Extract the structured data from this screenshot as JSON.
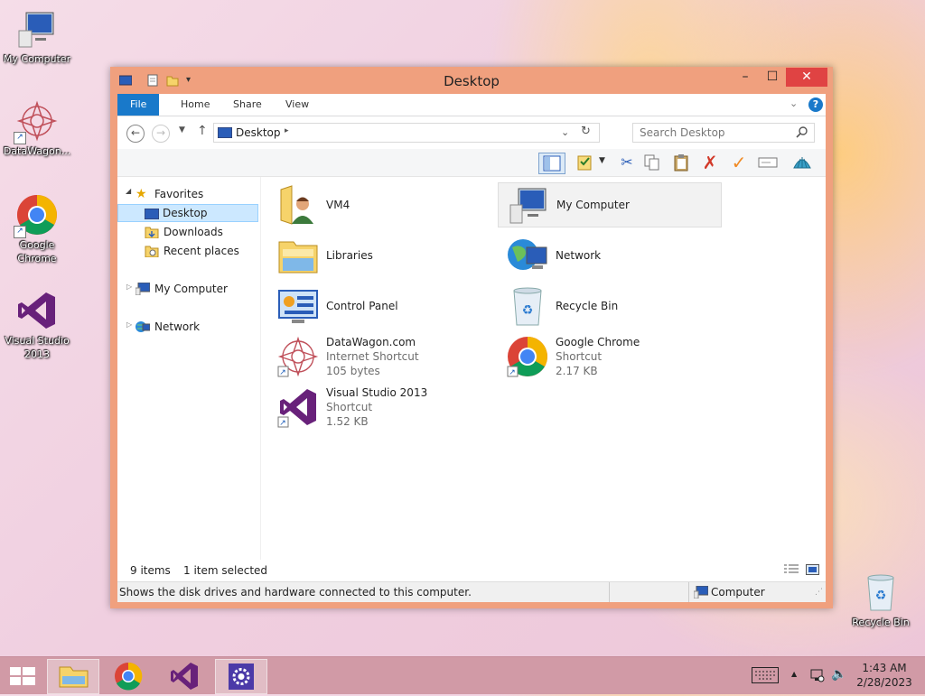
{
  "desktop": {
    "icons": [
      {
        "label": "My Computer",
        "icon": "my-computer-icon"
      },
      {
        "label": "DataWagon...",
        "icon": "datawagon-icon"
      },
      {
        "label": "Google Chrome",
        "icon": "chrome-icon"
      },
      {
        "label": "Visual Studio 2013",
        "icon": "visual-studio-icon"
      },
      {
        "label": "Recycle Bin",
        "icon": "recycle-bin-icon"
      }
    ]
  },
  "window": {
    "title": "Desktop",
    "controls": {
      "minimize": "–",
      "maximize": "☐",
      "close": "✕"
    },
    "ribbon": {
      "tabs": [
        "File",
        "Home",
        "Share",
        "View"
      ],
      "help": "?"
    },
    "address": {
      "location": "Desktop",
      "search_placeholder": "Search Desktop"
    },
    "nav_pane": {
      "favorites": "Favorites",
      "favorites_items": [
        "Desktop",
        "Downloads",
        "Recent places"
      ],
      "my_computer": "My Computer",
      "network": "Network"
    },
    "items": [
      {
        "name": "VM4",
        "sub1": "",
        "sub2": "",
        "icon": "user-folder-icon"
      },
      {
        "name": "My Computer",
        "sub1": "",
        "sub2": "",
        "icon": "my-computer-icon",
        "selected": true
      },
      {
        "name": "Libraries",
        "sub1": "",
        "sub2": "",
        "icon": "libraries-icon"
      },
      {
        "name": "Network",
        "sub1": "",
        "sub2": "",
        "icon": "network-icon"
      },
      {
        "name": "Control Panel",
        "sub1": "",
        "sub2": "",
        "icon": "control-panel-icon"
      },
      {
        "name": "Recycle Bin",
        "sub1": "",
        "sub2": "",
        "icon": "recycle-bin-icon"
      },
      {
        "name": "DataWagon.com",
        "sub1": "Internet Shortcut",
        "sub2": "105 bytes",
        "icon": "datawagon-icon"
      },
      {
        "name": "Google Chrome",
        "sub1": "Shortcut",
        "sub2": "2.17 KB",
        "icon": "chrome-icon"
      },
      {
        "name": "Visual Studio 2013",
        "sub1": "Shortcut",
        "sub2": "1.52 KB",
        "icon": "visual-studio-icon"
      }
    ],
    "status": {
      "item_count": "9 items",
      "selection": "1 item selected",
      "description": "Shows the disk drives and hardware connected to this computer.",
      "location": "Computer"
    }
  },
  "taskbar": {
    "time": "1:43 AM",
    "date": "2/28/2023",
    "apps": [
      "start-icon",
      "file-explorer-icon",
      "chrome-icon",
      "visual-studio-icon",
      "settings-icon"
    ]
  },
  "colors": {
    "window_border": "#f0a07e",
    "file_tab": "#1979ca",
    "taskbar": "#d19aa6",
    "selection": "#cce8ff",
    "vs_purple": "#68217a"
  }
}
